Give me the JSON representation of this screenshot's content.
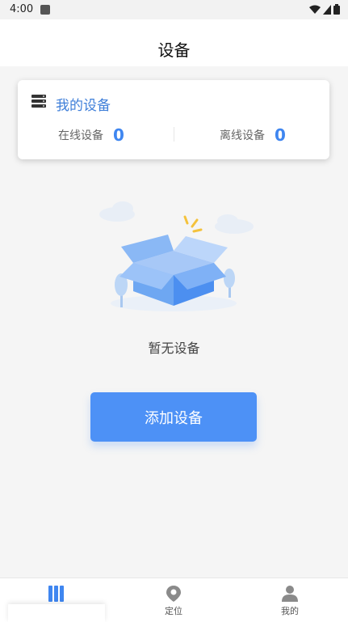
{
  "status_bar": {
    "time": "4:00"
  },
  "header": {
    "title": "设备"
  },
  "device_card": {
    "title": "我的设备",
    "online_label": "在线设备",
    "online_count": "0",
    "offline_label": "离线设备",
    "offline_count": "0"
  },
  "empty_state": {
    "message": "暂无设备"
  },
  "actions": {
    "add_device_label": "添加设备"
  },
  "tabbar": {
    "tabs": [
      {
        "label": "",
        "icon": "device-list-icon",
        "active": true
      },
      {
        "label": "定位",
        "icon": "location-pin-icon",
        "active": false
      },
      {
        "label": "我的",
        "icon": "person-icon",
        "active": false
      }
    ]
  },
  "colors": {
    "accent": "#4d91f6",
    "title_blue": "#3f7fd9",
    "count_blue": "#3f86f0"
  }
}
